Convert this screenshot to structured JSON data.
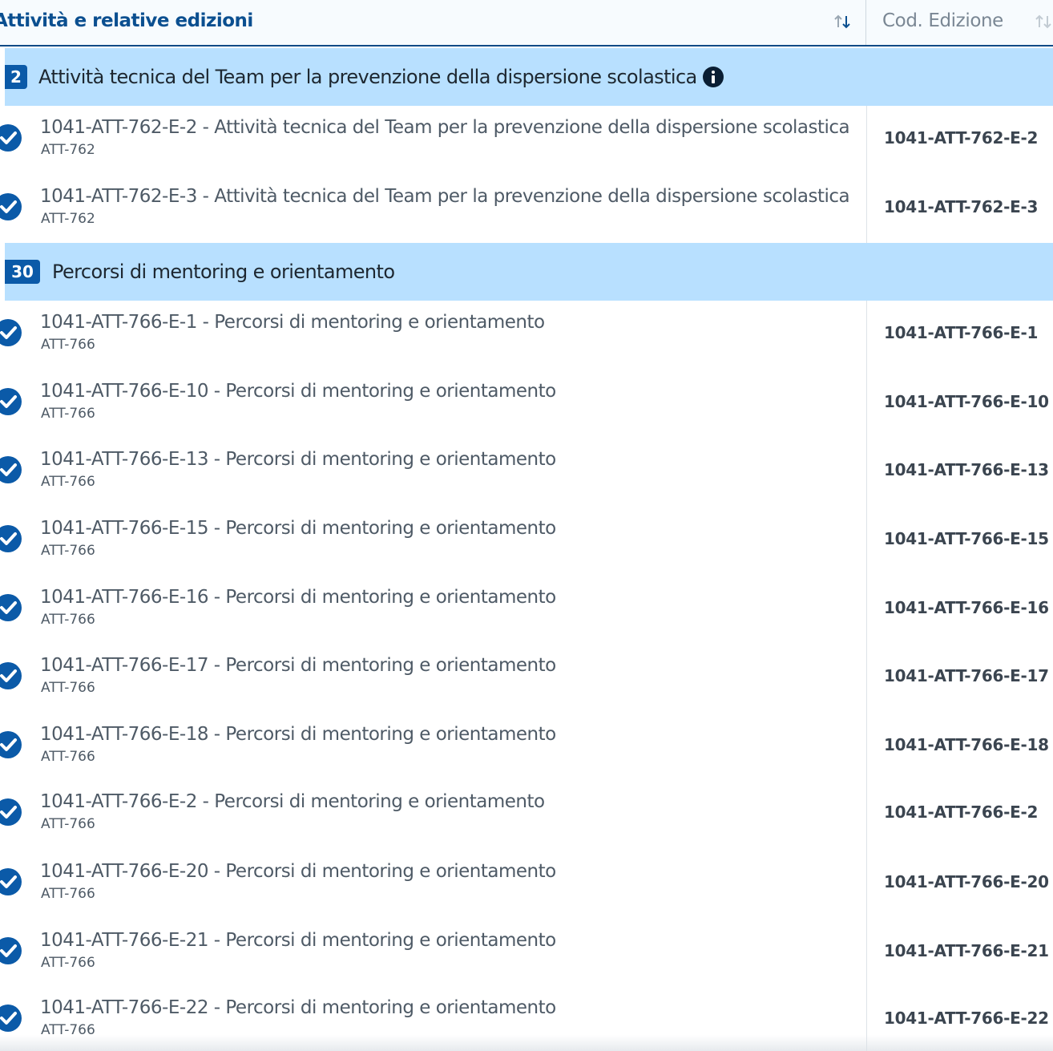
{
  "header": {
    "col1_title": "Attività e relative edizioni",
    "col2_title": "Cod. Edizione"
  },
  "groups": [
    {
      "badge": "2",
      "title": "Attività tecnica del Team per la prevenzione della dispersione scolastica",
      "has_info_icon": true,
      "items": [
        {
          "title": "1041-ATT-762-E-2 - Attività tecnica del Team per la prevenzione della dispersione scolastica",
          "sub": "ATT-762",
          "code": "1041-ATT-762-E-2"
        },
        {
          "title": "1041-ATT-762-E-3 - Attività tecnica del Team per la prevenzione della dispersione scolastica",
          "sub": "ATT-762",
          "code": "1041-ATT-762-E-3"
        }
      ]
    },
    {
      "badge": "30",
      "title": "Percorsi di mentoring e orientamento",
      "has_info_icon": false,
      "items": [
        {
          "title": "1041-ATT-766-E-1 - Percorsi di mentoring e orientamento",
          "sub": "ATT-766",
          "code": "1041-ATT-766-E-1"
        },
        {
          "title": "1041-ATT-766-E-10 - Percorsi di mentoring e orientamento",
          "sub": "ATT-766",
          "code": "1041-ATT-766-E-10"
        },
        {
          "title": "1041-ATT-766-E-13 - Percorsi di mentoring e orientamento",
          "sub": "ATT-766",
          "code": "1041-ATT-766-E-13"
        },
        {
          "title": "1041-ATT-766-E-15 - Percorsi di mentoring e orientamento",
          "sub": "ATT-766",
          "code": "1041-ATT-766-E-15"
        },
        {
          "title": "1041-ATT-766-E-16 - Percorsi di mentoring e orientamento",
          "sub": "ATT-766",
          "code": "1041-ATT-766-E-16"
        },
        {
          "title": "1041-ATT-766-E-17 - Percorsi di mentoring e orientamento",
          "sub": "ATT-766",
          "code": "1041-ATT-766-E-17"
        },
        {
          "title": "1041-ATT-766-E-18 - Percorsi di mentoring e orientamento",
          "sub": "ATT-766",
          "code": "1041-ATT-766-E-18"
        },
        {
          "title": "1041-ATT-766-E-2 - Percorsi di mentoring e orientamento",
          "sub": "ATT-766",
          "code": "1041-ATT-766-E-2"
        },
        {
          "title": "1041-ATT-766-E-20 - Percorsi di mentoring e orientamento",
          "sub": "ATT-766",
          "code": "1041-ATT-766-E-20"
        },
        {
          "title": "1041-ATT-766-E-21 - Percorsi di mentoring e orientamento",
          "sub": "ATT-766",
          "code": "1041-ATT-766-E-21"
        },
        {
          "title": "1041-ATT-766-E-22 - Percorsi di mentoring e orientamento",
          "sub": "ATT-766",
          "code": "1041-ATT-766-E-22"
        }
      ]
    }
  ],
  "icons": {
    "sort": "sort-arrows-icon",
    "check": "check-circle-icon",
    "info": "info-circle-icon"
  },
  "colors": {
    "group_background": "#b8e0ff",
    "badge": "#0b5aa8",
    "header_text": "#0b4f90",
    "check": "#0b5aa8"
  }
}
